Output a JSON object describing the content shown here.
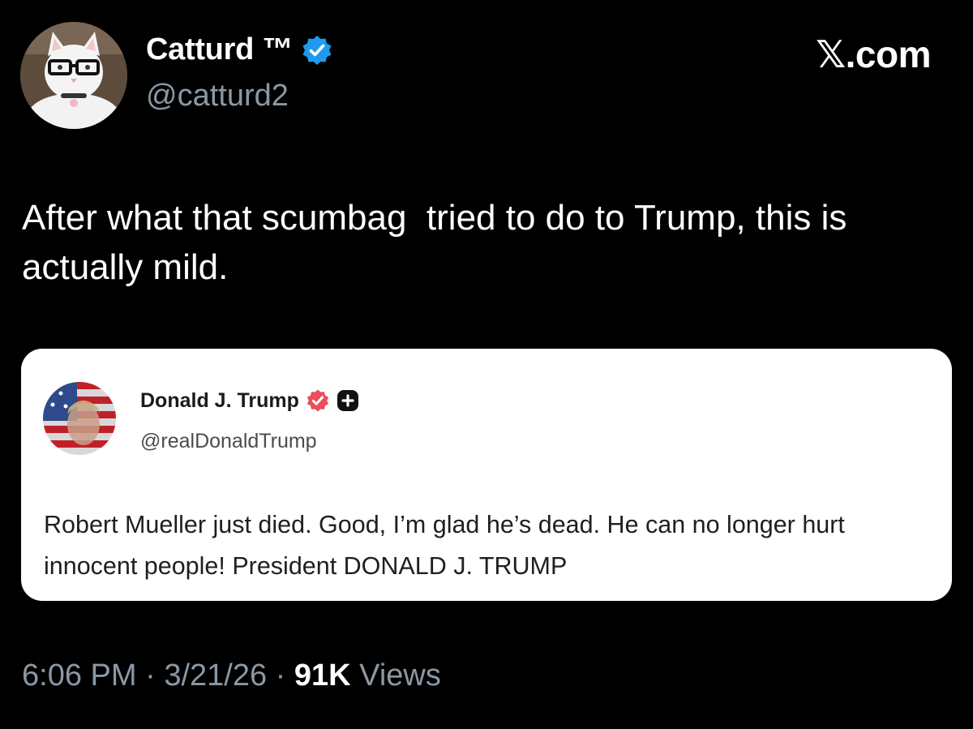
{
  "author": {
    "display_name": "Catturd ™",
    "handle": "@catturd2",
    "avatar_icon": "cat-with-glasses-avatar",
    "verified_color": "#1d9bf0"
  },
  "brand": {
    "label": "𝕏.com"
  },
  "tweet": {
    "text": "After what that scumbag  tried to do to Trump, this is actually mild."
  },
  "quoted_post": {
    "display_name": "Donald J. Trump",
    "handle": "@realDonaldTrump",
    "avatar_icon": "flag-portrait-avatar",
    "badge_color": "#e8505b",
    "text": "Robert Mueller just died. Good, I’m glad he’s dead. He can no longer hurt innocent people! President DONALD J. TRUMP"
  },
  "meta": {
    "time": "6:06 PM",
    "separator": " · ",
    "date": "3/21/26",
    "views_count": "91K",
    "views_label": "Views"
  },
  "colors": {
    "background": "#000000",
    "primary_text": "#ffffff",
    "secondary_text": "#8b98a5",
    "card_background": "#ffffff"
  }
}
